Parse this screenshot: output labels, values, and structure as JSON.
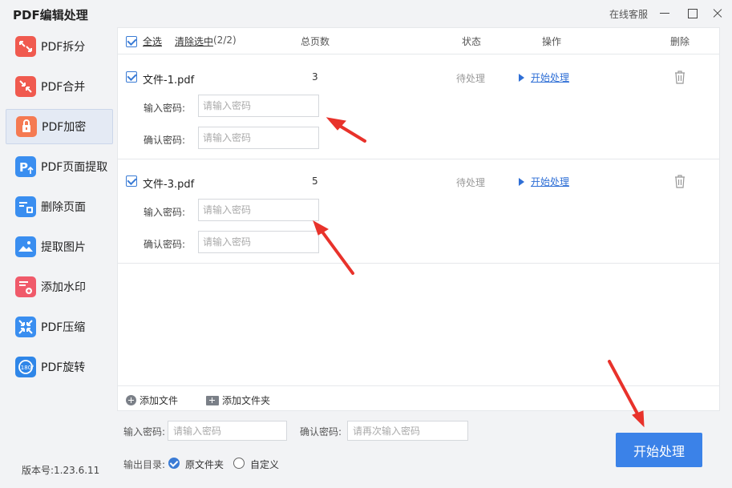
{
  "window": {
    "title": "PDF编辑处理",
    "online_service": "在线客服"
  },
  "sidebar": {
    "items": [
      {
        "label": "PDF拆分",
        "icon": "split-icon",
        "color": "#f05a4f"
      },
      {
        "label": "PDF合并",
        "icon": "merge-icon",
        "color": "#f05a4f"
      },
      {
        "label": "PDF加密",
        "icon": "lock-icon",
        "color": "#f57a52",
        "active": true
      },
      {
        "label": "PDF页面提取",
        "icon": "page-extract-icon",
        "color": "#3a8ef0"
      },
      {
        "label": "删除页面",
        "icon": "delete-page-icon",
        "color": "#3a8ef0"
      },
      {
        "label": "提取图片",
        "icon": "image-extract-icon",
        "color": "#3a8ef0"
      },
      {
        "label": "添加水印",
        "icon": "watermark-icon",
        "color": "#f05a6a"
      },
      {
        "label": "PDF压缩",
        "icon": "compress-icon",
        "color": "#3a8ef0"
      },
      {
        "label": "PDF旋转",
        "icon": "rotate-icon",
        "color": "#2f86e8"
      }
    ],
    "version": "版本号:1.23.6.11"
  },
  "table": {
    "select_all": "全选",
    "clear_selected": "清除选中",
    "selected_count": "(2/2)",
    "col_pages": "总页数",
    "col_status": "状态",
    "col_action": "操作",
    "col_delete": "删除"
  },
  "files": [
    {
      "name": "文件-1.pdf",
      "pages": "3",
      "status": "待处理",
      "action": "开始处理",
      "password_label": "输入密码:",
      "password_placeholder": "请输入密码",
      "confirm_label": "确认密码:",
      "confirm_placeholder": "请输入密码"
    },
    {
      "name": "文件-3.pdf",
      "pages": "5",
      "status": "待处理",
      "action": "开始处理",
      "password_label": "输入密码:",
      "password_placeholder": "请输入密码",
      "confirm_label": "确认密码:",
      "confirm_placeholder": "请输入密码"
    }
  ],
  "add_bar": {
    "add_file": "添加文件",
    "add_folder": "添加文件夹"
  },
  "bottom": {
    "password_label": "输入密码:",
    "password_placeholder": "请输入密码",
    "confirm_label": "确认密码:",
    "confirm_placeholder": "请再次输入密码",
    "output_label": "输出目录:",
    "option_original": "原文件夹",
    "option_custom": "自定义",
    "start_button": "开始处理"
  },
  "colors": {
    "accent": "#3b82e8",
    "link": "#2f6fd6",
    "annotation_arrow": "#e8322b"
  }
}
